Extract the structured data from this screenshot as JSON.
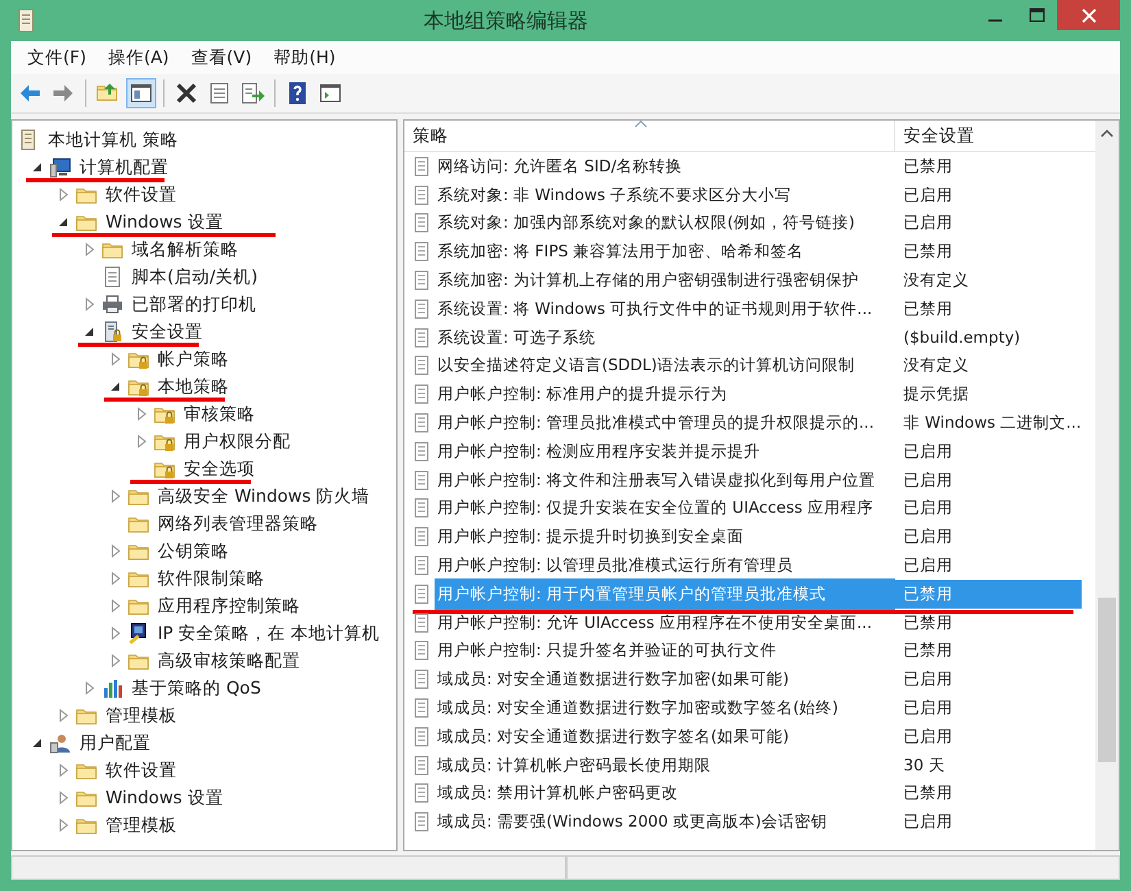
{
  "window": {
    "title": "本地组策略编辑器"
  },
  "menu": [
    "文件(F)",
    "操作(A)",
    "查看(V)",
    "帮助(H)"
  ],
  "toolbar": [
    {
      "kind": "back",
      "pressed": false
    },
    {
      "kind": "forward",
      "pressed": false
    },
    {
      "kind": "sep"
    },
    {
      "kind": "up",
      "pressed": false
    },
    {
      "kind": "tree",
      "pressed": true
    },
    {
      "kind": "sep"
    },
    {
      "kind": "delete",
      "pressed": false
    },
    {
      "kind": "properties",
      "pressed": false
    },
    {
      "kind": "export",
      "pressed": false
    },
    {
      "kind": "sep"
    },
    {
      "kind": "help",
      "pressed": false
    },
    {
      "kind": "view",
      "pressed": false
    }
  ],
  "tree": [
    {
      "label": "本地计算机 策略",
      "kind": "policy",
      "marked": false,
      "children": [
        {
          "label": "计算机配置",
          "kind": "computer",
          "expanded": true,
          "marked": true,
          "children": [
            {
              "label": "软件设置",
              "kind": "folder",
              "expanded": false,
              "marked": false
            },
            {
              "label": "Windows 设置",
              "kind": "folder",
              "expanded": true,
              "marked": true,
              "children": [
                {
                  "label": "域名解析策略",
                  "kind": "folder",
                  "expanded": false,
                  "marked": false
                },
                {
                  "label": "脚本(启动/关机)",
                  "kind": "script",
                  "marked": false
                },
                {
                  "label": "已部署的打印机",
                  "kind": "printer",
                  "expanded": false,
                  "marked": false
                },
                {
                  "label": "安全设置",
                  "kind": "security",
                  "expanded": true,
                  "marked": true,
                  "children": [
                    {
                      "label": "帐户策略",
                      "kind": "lockfolder",
                      "expanded": false,
                      "marked": false
                    },
                    {
                      "label": "本地策略",
                      "kind": "lockfolder",
                      "expanded": true,
                      "marked": true,
                      "children": [
                        {
                          "label": "审核策略",
                          "kind": "lockfolder",
                          "expanded": false,
                          "marked": false
                        },
                        {
                          "label": "用户权限分配",
                          "kind": "lockfolder",
                          "expanded": false,
                          "marked": false
                        },
                        {
                          "label": "安全选项",
                          "kind": "lockfolder",
                          "marked": true
                        }
                      ]
                    },
                    {
                      "label": "高级安全 Windows 防火墙",
                      "kind": "folder",
                      "expanded": false,
                      "marked": false
                    },
                    {
                      "label": "网络列表管理器策略",
                      "kind": "folder",
                      "marked": false
                    },
                    {
                      "label": "公钥策略",
                      "kind": "folder",
                      "expanded": false,
                      "marked": false
                    },
                    {
                      "label": "软件限制策略",
                      "kind": "folder",
                      "expanded": false,
                      "marked": false
                    },
                    {
                      "label": "应用程序控制策略",
                      "kind": "folder",
                      "expanded": false,
                      "marked": false
                    },
                    {
                      "label": "IP 安全策略，在 本地计算机",
                      "kind": "ipsec",
                      "expanded": false,
                      "marked": false
                    },
                    {
                      "label": "高级审核策略配置",
                      "kind": "folder",
                      "expanded": false,
                      "marked": false
                    }
                  ]
                },
                {
                  "label": "基于策略的 QoS",
                  "kind": "qos",
                  "expanded": false,
                  "marked": false
                }
              ]
            },
            {
              "label": "管理模板",
              "kind": "folder",
              "expanded": false,
              "marked": false
            }
          ]
        },
        {
          "label": "用户配置",
          "kind": "user",
          "expanded": true,
          "marked": false,
          "children": [
            {
              "label": "软件设置",
              "kind": "folder",
              "expanded": false,
              "marked": false
            },
            {
              "label": "Windows 设置",
              "kind": "folder",
              "expanded": false,
              "marked": false
            },
            {
              "label": "管理模板",
              "kind": "folder",
              "expanded": false,
              "marked": false
            }
          ]
        }
      ]
    }
  ],
  "table": {
    "columns": [
      "策略",
      "安全设置"
    ],
    "rows": [
      {
        "policy": "网络访问: 允许匿名 SID/名称转换",
        "setting": "已禁用",
        "selected": false,
        "marked": false
      },
      {
        "policy": "系统对象: 非 Windows 子系统不要求区分大小写",
        "setting": "已启用",
        "selected": false,
        "marked": false
      },
      {
        "policy": "系统对象: 加强内部系统对象的默认权限(例如，符号链接)",
        "setting": "已启用",
        "selected": false,
        "marked": false
      },
      {
        "policy": "系统加密: 将 FIPS 兼容算法用于加密、哈希和签名",
        "setting": "已禁用",
        "selected": false,
        "marked": false
      },
      {
        "policy": "系统加密: 为计算机上存储的用户密钥强制进行强密钥保护",
        "setting": "没有定义",
        "selected": false,
        "marked": false
      },
      {
        "policy": "系统设置: 将 Windows 可执行文件中的证书规则用于软件...",
        "setting": "已禁用",
        "selected": false,
        "marked": false
      },
      {
        "policy": "系统设置: 可选子系统",
        "setting": "($build.empty)",
        "selected": false,
        "marked": false
      },
      {
        "policy": "以安全描述符定义语言(SDDL)语法表示的计算机访问限制",
        "setting": "没有定义",
        "selected": false,
        "marked": false
      },
      {
        "policy": "用户帐户控制: 标准用户的提升提示行为",
        "setting": "提示凭据",
        "selected": false,
        "marked": false
      },
      {
        "policy": "用户帐户控制: 管理员批准模式中管理员的提升权限提示的...",
        "setting": "非 Windows 二进制文...",
        "selected": false,
        "marked": false
      },
      {
        "policy": "用户帐户控制: 检测应用程序安装并提示提升",
        "setting": "已启用",
        "selected": false,
        "marked": false
      },
      {
        "policy": "用户帐户控制: 将文件和注册表写入错误虚拟化到每用户位置",
        "setting": "已启用",
        "selected": false,
        "marked": false
      },
      {
        "policy": "用户帐户控制: 仅提升安装在安全位置的 UIAccess 应用程序",
        "setting": "已启用",
        "selected": false,
        "marked": false
      },
      {
        "policy": "用户帐户控制: 提示提升时切换到安全桌面",
        "setting": "已启用",
        "selected": false,
        "marked": false
      },
      {
        "policy": "用户帐户控制: 以管理员批准模式运行所有管理员",
        "setting": "已启用",
        "selected": false,
        "marked": false
      },
      {
        "policy": "用户帐户控制: 用于内置管理员帐户的管理员批准模式",
        "setting": "已禁用",
        "selected": true,
        "marked": true
      },
      {
        "policy": "用户帐户控制: 允许 UIAccess 应用程序在不使用安全桌面...",
        "setting": "已禁用",
        "selected": false,
        "marked": false
      },
      {
        "policy": "用户帐户控制: 只提升签名并验证的可执行文件",
        "setting": "已禁用",
        "selected": false,
        "marked": false
      },
      {
        "policy": "域成员: 对安全通道数据进行数字加密(如果可能)",
        "setting": "已启用",
        "selected": false,
        "marked": false
      },
      {
        "policy": "域成员: 对安全通道数据进行数字加密或数字签名(始终)",
        "setting": "已启用",
        "selected": false,
        "marked": false
      },
      {
        "policy": "域成员: 对安全通道数据进行数字签名(如果可能)",
        "setting": "已启用",
        "selected": false,
        "marked": false
      },
      {
        "policy": "域成员: 计算机帐户密码最长使用期限",
        "setting": "30 天",
        "selected": false,
        "marked": false
      },
      {
        "policy": "域成员: 禁用计算机帐户密码更改",
        "setting": "已禁用",
        "selected": false,
        "marked": false
      },
      {
        "policy": "域成员: 需要强(Windows 2000 或更高版本)会话密钥",
        "setting": "已启用",
        "selected": false,
        "marked": false
      }
    ]
  }
}
